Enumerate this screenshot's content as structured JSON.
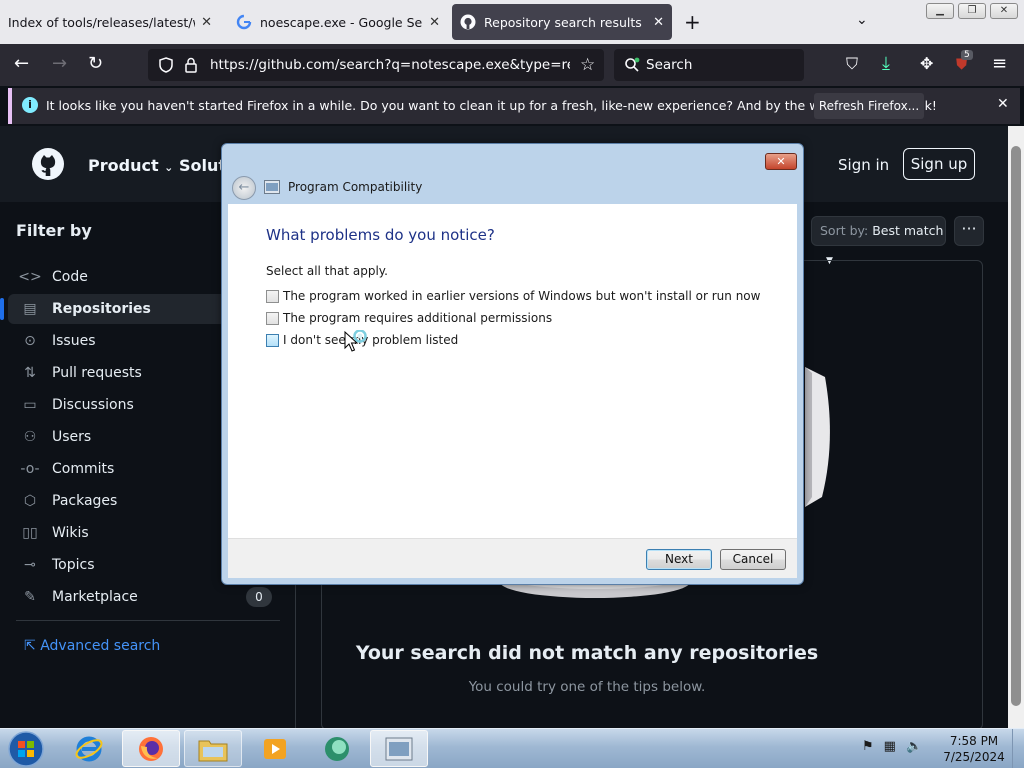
{
  "browser": {
    "tabs": [
      {
        "label": "Index of tools/releases/latest/windo",
        "active": false
      },
      {
        "label": "noescape.exe - Google Search",
        "active": false
      },
      {
        "label": "Repository search results · GitHu",
        "active": true
      }
    ],
    "new_tab": "+",
    "tab_list": "⌄",
    "url": "https://github.com/search?q=notescape.exe&type=reposit",
    "search_placeholder": "Search",
    "extension_badge": "5",
    "notification": {
      "text": "It looks like you haven't started Firefox in a while. Do you want to clean it up for a fresh, like-new experience? And by the way, welcome back!",
      "button": "Refresh Firefox..."
    }
  },
  "github": {
    "nav": [
      "Product",
      "Soluti"
    ],
    "sign_in": "Sign in",
    "sign_up": "Sign up",
    "filter_title": "Filter by",
    "filters": [
      {
        "label": "Code",
        "icon": "code-icon",
        "glyph": "<>"
      },
      {
        "label": "Repositories",
        "icon": "repo-icon",
        "glyph": "▤",
        "selected": true
      },
      {
        "label": "Issues",
        "icon": "issue-icon",
        "glyph": "⊙"
      },
      {
        "label": "Pull requests",
        "icon": "pull-request-icon",
        "glyph": "⇅"
      },
      {
        "label": "Discussions",
        "icon": "discussion-icon",
        "glyph": "▭"
      },
      {
        "label": "Users",
        "icon": "users-icon",
        "glyph": "⚇"
      },
      {
        "label": "Commits",
        "icon": "commit-icon",
        "glyph": "-o-"
      },
      {
        "label": "Packages",
        "icon": "package-icon",
        "glyph": "⬡"
      },
      {
        "label": "Wikis",
        "icon": "book-icon",
        "glyph": "▯▯"
      },
      {
        "label": "Topics",
        "icon": "tag-icon",
        "glyph": "⊸"
      },
      {
        "label": "Marketplace",
        "icon": "marketplace-icon",
        "glyph": "✎"
      }
    ],
    "marketplace_count": "0",
    "advanced_search": "Advanced search",
    "sort_label": "Sort by:",
    "sort_value": "Best match",
    "no_match_title": "Your search did not match any repositories",
    "no_match_sub": "You could try one of the tips below."
  },
  "dialog": {
    "title": "Program Compatibility",
    "heading": "What problems do you notice?",
    "instruction": "Select all that apply.",
    "options": [
      "The program worked in earlier versions of Windows but won't install or run now",
      "The program requires additional permissions",
      "I don't see my problem listed"
    ],
    "next": "Next",
    "cancel": "Cancel",
    "close": "✕"
  },
  "taskbar": {
    "time": "7:58 PM",
    "date": "7/25/2024"
  },
  "colors": {
    "firefox_dark": "#2b2a33",
    "github_bg": "#0d1117",
    "dialog_frame": "#bcd3ea",
    "dialog_heading": "#1e3287"
  }
}
